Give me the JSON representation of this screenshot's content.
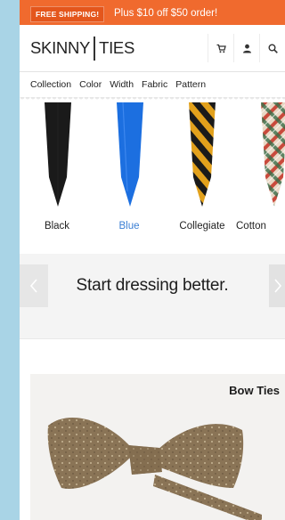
{
  "promo": {
    "badge": "FREE SHIPPING!",
    "offer": "Plus $10 off $50 order!"
  },
  "header": {
    "logo_left": "SKINNY",
    "logo_right": "TIES",
    "icons": [
      "cart-icon",
      "user-icon",
      "search-icon"
    ]
  },
  "nav": {
    "items": [
      "Collection",
      "Color",
      "Width",
      "Fabric",
      "Pattern"
    ]
  },
  "carousel": {
    "items": [
      {
        "label": "Black",
        "color": "#1a1a1a",
        "active": false
      },
      {
        "label": "Blue",
        "color": "#1c6fe0",
        "active": true
      },
      {
        "label": "Collegiate",
        "color": "#e2a11c",
        "active": false
      },
      {
        "label": "Cotton",
        "color": "#c94a3c",
        "active": false
      }
    ]
  },
  "banner": {
    "tagline": "Start dressing better."
  },
  "category": {
    "title": "Bow Ties"
  },
  "colors": {
    "promo": "#f06a2e",
    "accent": "#3b7fd4",
    "background": "#a9d4e6"
  }
}
